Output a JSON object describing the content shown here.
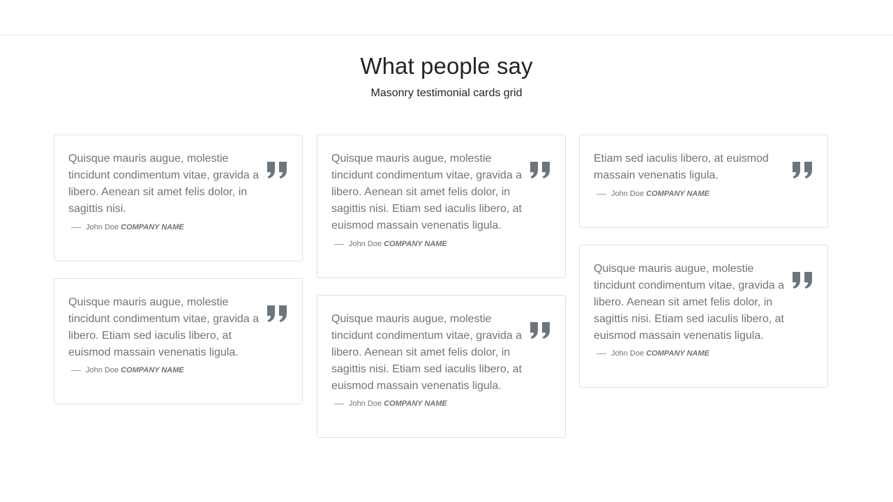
{
  "header": {
    "title": "What people say",
    "subtitle": "Masonry testimonial cards grid"
  },
  "testimonials": [
    {
      "text": "Quisque mauris augue, molestie tincidunt condimentum vitae, gravida a libero. Aenean sit amet felis dolor, in sagittis nisi.",
      "author": "John Doe",
      "company": "COMPANY NAME"
    },
    {
      "text": "Quisque mauris augue, molestie tincidunt condimentum vitae, gravida a libero. Etiam sed iaculis libero, at euismod massain venenatis ligula.",
      "author": "John Doe",
      "company": "COMPANY NAME"
    },
    {
      "text": "Quisque mauris augue, molestie tincidunt condimentum vitae, gravida a libero. Aenean sit amet felis dolor, in sagittis nisi. Etiam sed iaculis libero, at euismod massain venenatis ligula.",
      "author": "John Doe",
      "company": "COMPANY NAME"
    },
    {
      "text": "Quisque mauris augue, molestie tincidunt condimentum vitae, gravida a libero. Aenean sit amet felis dolor, in sagittis nisi. Etiam sed iaculis libero, at euismod massain venenatis ligula.",
      "author": "John Doe",
      "company": "COMPANY NAME"
    },
    {
      "text": "Etiam sed iaculis libero, at euismod massain venenatis ligula.",
      "author": "John Doe",
      "company": "COMPANY NAME"
    },
    {
      "text": "Quisque mauris augue, molestie tincidunt condimentum vitae, gravida a libero. Aenean sit amet felis dolor, in sagittis nisi. Etiam sed iaculis libero, at euismod massain venenatis ligula.",
      "author": "John Doe",
      "company": "COMPANY NAME"
    }
  ],
  "icons": {
    "quote": "quote-icon"
  },
  "colors": {
    "text_muted": "#6c757d",
    "border": "#dfe1e4"
  }
}
